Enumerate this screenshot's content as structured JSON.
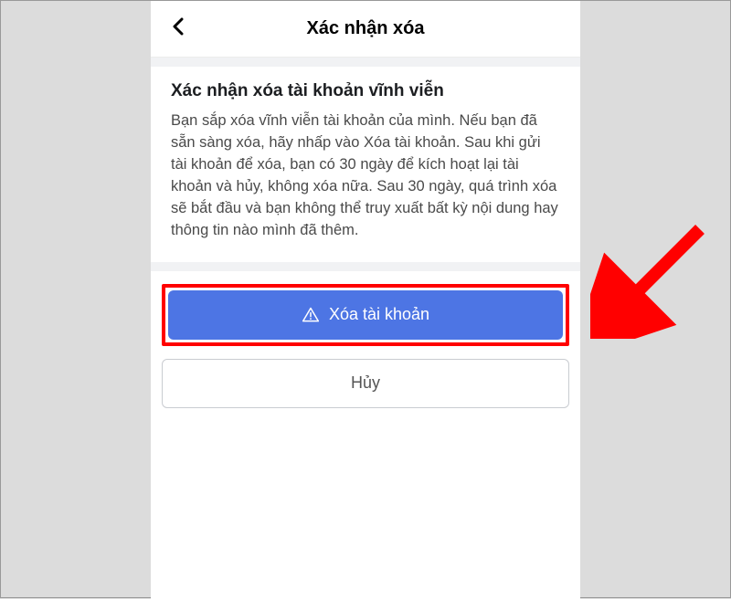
{
  "header": {
    "title": "Xác nhận xóa"
  },
  "content": {
    "title": "Xác nhận xóa tài khoản vĩnh viễn",
    "body": "Bạn sắp xóa vĩnh viễn tài khoản của mình. Nếu bạn đã sẵn sàng xóa, hãy nhấp vào Xóa tài khoản. Sau khi gửi tài khoản để xóa, bạn có 30 ngày để kích hoạt lại tài khoản và hủy, không xóa nữa. Sau 30 ngày, quá trình xóa sẽ bắt đầu và bạn không thể truy xuất bất kỳ nội dung hay thông tin nào mình đã thêm."
  },
  "buttons": {
    "delete_label": "Xóa tài khoản",
    "cancel_label": "Hủy"
  },
  "colors": {
    "primary": "#4d75e4",
    "highlight_border": "#ff0000",
    "arrow": "#ff0000"
  }
}
